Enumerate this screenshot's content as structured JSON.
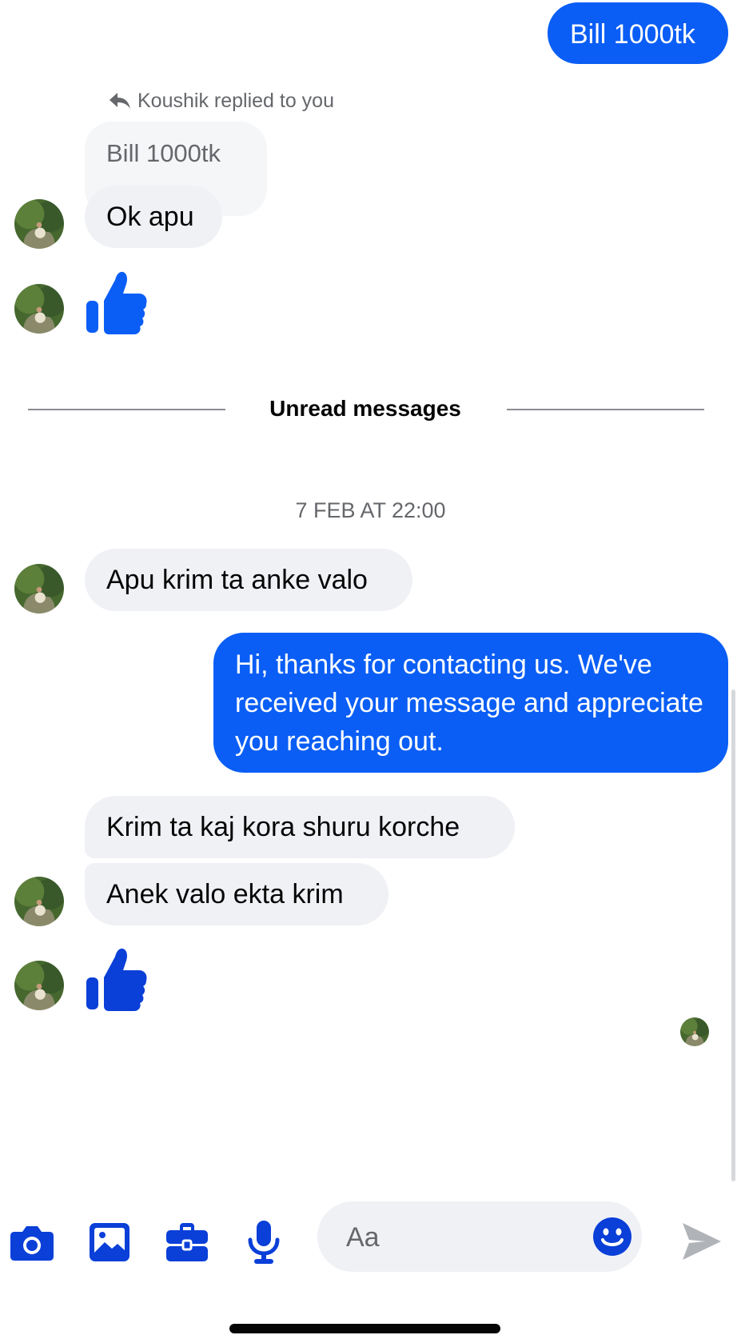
{
  "messages": {
    "out_bill": "Bill 1000tk",
    "reply_context": "Koushik replied to you",
    "quoted_reply": "Bill 1000tk",
    "ok_apu": "Ok apu",
    "apu_krim": "Apu krim ta anke valo",
    "auto_reply": "Hi, thanks for contacting us. We've received your message and appreciate you reaching out.",
    "krim_kaj": "Krim ta kaj kora shuru korche",
    "anek_valo": "Anek valo ekta krim"
  },
  "divider": {
    "unread_label": "Unread messages"
  },
  "timestamp": "7 FEB AT 22:00",
  "composer": {
    "placeholder": "Aa"
  },
  "colors": {
    "accent": "#0a5ef5",
    "icon_blue": "#0a3fd8",
    "incoming_bubble": "#f0f1f5",
    "send_disabled": "#b0b3b8"
  },
  "icons": {
    "toolbar": [
      "camera-icon",
      "gallery-icon",
      "briefcase-icon",
      "microphone-icon"
    ],
    "composer": [
      "emoji-icon",
      "send-icon"
    ],
    "reactions": [
      "thumbs-up-icon"
    ]
  }
}
